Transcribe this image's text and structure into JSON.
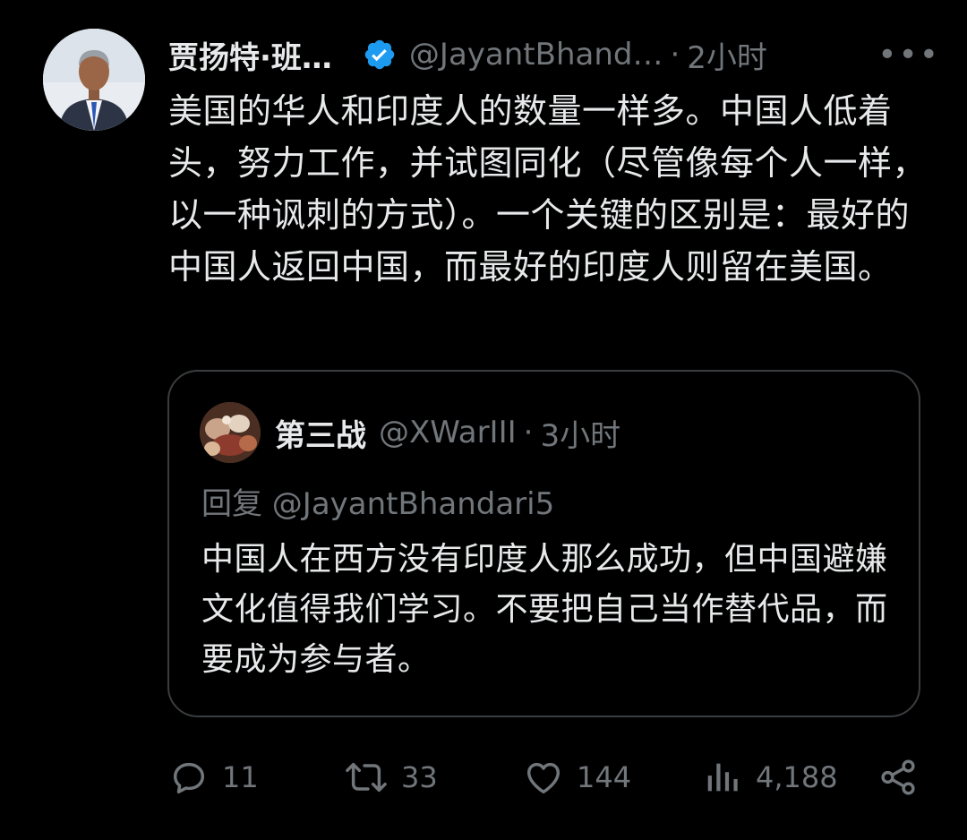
{
  "tweet": {
    "author_name": "贾扬特·班…",
    "handle": "@JayantBhand…",
    "separator": "·",
    "time": "2小时",
    "more_label": "•••",
    "text": "美国的华人和印度人的数量一样多。中国人低着头，努力工作，并试图同化（尽管像每个人一样，以一种讽刺的方式）。一个关键的区别是：最好的中国人返回中国，而最好的印度人则留在美国。"
  },
  "quote": {
    "author_name": "第三战",
    "handle": "@XWarIII",
    "separator": "·",
    "time": "3小时",
    "reply_to": "回复 @JayantBhandari5",
    "text": "中国人在西方没有印度人那么成功，但中国避嫌文化值得我们学习。不要把自己当作替代品，而要成为参与者。"
  },
  "actions": {
    "replies": "11",
    "retweets": "33",
    "likes": "144",
    "views": "4,188"
  },
  "colors": {
    "background": "#000000",
    "text": "#e7e9ea",
    "muted": "#71767b",
    "verified": "#1d9bf0",
    "border": "#3a3d40"
  },
  "icons": [
    "verified-badge-icon",
    "reply-icon",
    "retweet-icon",
    "like-icon",
    "views-icon",
    "share-icon"
  ]
}
